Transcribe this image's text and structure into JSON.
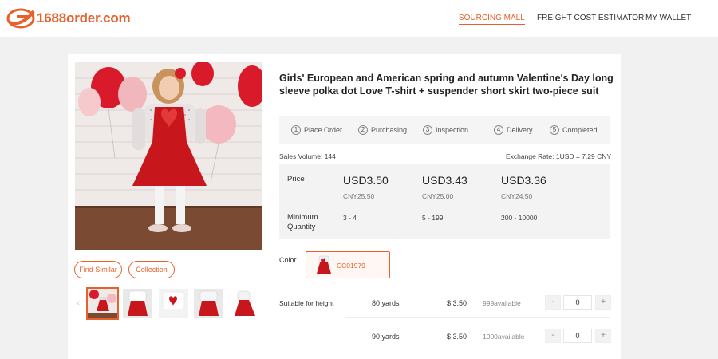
{
  "header": {
    "logo_text": "1688order.com",
    "nav": [
      {
        "label": "SOURCING MALL",
        "active": true
      },
      {
        "label": "FREIGHT COST ESTIMATOR",
        "active": false
      },
      {
        "label": "MY WALLET",
        "active": false
      }
    ]
  },
  "product": {
    "title": "Girls' European and American spring and autumn Valentine's Day long sleeve polka dot Love T-shirt + suspender short skirt two-piece suit",
    "find_similar_label": "Find Similar",
    "collection_label": "Collection",
    "thumbnail_count": 5,
    "active_thumbnail": 0
  },
  "steps": [
    {
      "num": "1",
      "label": "Place Order"
    },
    {
      "num": "2",
      "label": "Purchasing"
    },
    {
      "num": "3",
      "label": "Inspection..."
    },
    {
      "num": "4",
      "label": "Delivery"
    },
    {
      "num": "5",
      "label": "Completed"
    }
  ],
  "meta": {
    "sales_volume": "Sales Volume:  144",
    "exchange_rate": "Exchange Rate: 1USD = 7.29 CNY"
  },
  "pricing": {
    "price_label": "Price",
    "min_qty_label": "Minimum Quantity",
    "tiers": [
      {
        "usd": "USD3.50",
        "cny": "CNY25.50",
        "qty": "3 - 4"
      },
      {
        "usd": "USD3.43",
        "cny": "CNY25.00",
        "qty": "5 - 199"
      },
      {
        "usd": "USD3.36",
        "cny": "CNY24.50",
        "qty": "200 - 10000"
      }
    ]
  },
  "color": {
    "label": "Color",
    "selected": "CC01979"
  },
  "sizes": {
    "label": "Suitable for height",
    "rows": [
      {
        "size": "80 yards",
        "price": "$ 3.50",
        "available": "999available",
        "qty": "0",
        "minus": "-",
        "plus": "+"
      },
      {
        "size": "90 yards",
        "price": "$ 3.50",
        "available": "1000available",
        "qty": "0",
        "minus": "-",
        "plus": "+"
      }
    ]
  },
  "colors": {
    "accent": "#e8612c",
    "dress_red": "#c8161d"
  }
}
